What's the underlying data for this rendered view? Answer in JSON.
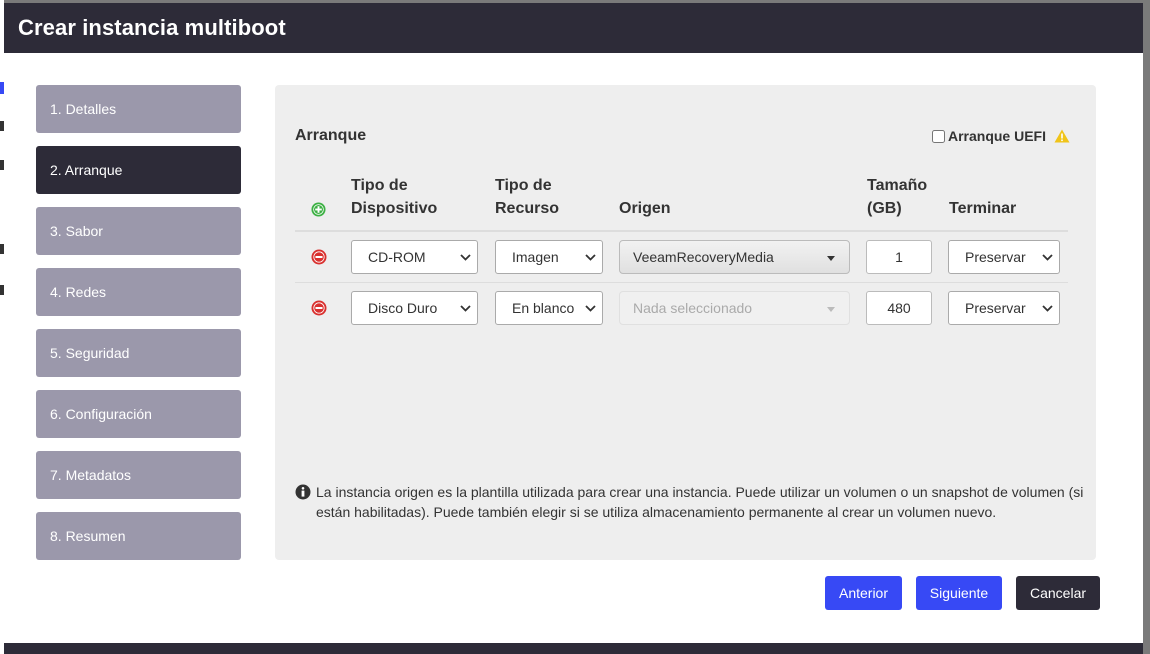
{
  "dialog": {
    "title": "Crear instancia multiboot"
  },
  "steps": [
    {
      "label": "1. Detalles"
    },
    {
      "label": "2. Arranque"
    },
    {
      "label": "3. Sabor"
    },
    {
      "label": "4. Redes"
    },
    {
      "label": "5. Seguridad"
    },
    {
      "label": "6. Configuración"
    },
    {
      "label": "7. Metadatos"
    },
    {
      "label": "8. Resumen"
    }
  ],
  "active_step": 1,
  "boot": {
    "title": "Arranque",
    "uefi_label": "Arranque UEFI",
    "uefi_checked": false,
    "columns": {
      "device_type": "Tipo de Dispositivo",
      "resource_type": "Tipo de Recurso",
      "origin": "Origen",
      "size": "Tamaño (GB)",
      "terminate": "Terminar"
    },
    "rows": [
      {
        "device_type": "CD-ROM",
        "resource_type": "Imagen",
        "origin": "VeeamRecoveryMedia",
        "origin_enabled": true,
        "size": "1",
        "terminate": "Preservar"
      },
      {
        "device_type": "Disco Duro",
        "resource_type": "En blanco",
        "origin": "Nada seleccionado",
        "origin_enabled": false,
        "size": "480",
        "terminate": "Preservar"
      }
    ],
    "info_text": "La instancia origen es la plantilla utilizada para crear una instancia. Puede utilizar un volumen o un snapshot de volumen (si están habilitadas). Puede también elegir si se utiliza almacenamiento permanente al crear un volumen nuevo."
  },
  "buttons": {
    "previous": "Anterior",
    "next": "Siguiente",
    "cancel": "Cancelar"
  },
  "colors": {
    "header": "#2d2b38",
    "step_inactive": "#9b98ab",
    "step_active": "#2d2b38",
    "primary": "#3749f5",
    "add_green": "#3cb043",
    "remove_red": "#d9302e",
    "warning": "#f0c419"
  }
}
